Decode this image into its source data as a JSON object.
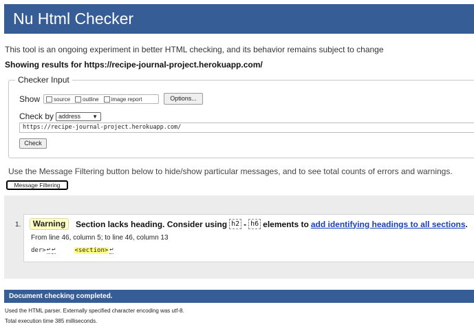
{
  "header": {
    "title": "Nu Html Checker"
  },
  "intro": "This tool is an ongoing experiment in better HTML checking, and its behavior remains subject to change",
  "showing": "Showing results for https://recipe-journal-project.herokuapp.com/",
  "checker_input": {
    "legend": "Checker Input",
    "show_label": "Show",
    "show_options": [
      {
        "label": "source",
        "checked": false
      },
      {
        "label": "outline",
        "checked": false
      },
      {
        "label": "image report",
        "checked": false
      }
    ],
    "options_button": "Options...",
    "check_by_label": "Check by",
    "check_by_value": "address",
    "url_value": "https://recipe-journal-project.herokuapp.com/",
    "check_button": "Check"
  },
  "filter": {
    "text": "Use the Message Filtering button below to hide/show particular messages, and to see total counts of errors and warnings.",
    "button": "Message Filtering"
  },
  "message": {
    "number": "1.",
    "type": "Warning",
    "text_before": "Section lacks heading. Consider using",
    "code1": "h2",
    "dash": "-",
    "code2": "h6",
    "text_after": "elements to",
    "link": "add identifying headings to all sections",
    "period": ".",
    "location": "From line 46, column 5; to line 46, column 13",
    "extract_prefix": "der>",
    "extract_lf1": "↩",
    "extract_lf2": "↩",
    "extract_highlight": "<section>",
    "extract_lf3": "↩"
  },
  "completed": "Document checking completed.",
  "footer": {
    "parser": "Used the HTML parser. Externally specified character encoding was utf-8.",
    "time": "Total execution time 385 milliseconds."
  },
  "colors": {
    "accent": "#365d95",
    "warning_bg": "#ffffc6",
    "highlight": "#ffff80",
    "link": "#1a3fbf"
  }
}
